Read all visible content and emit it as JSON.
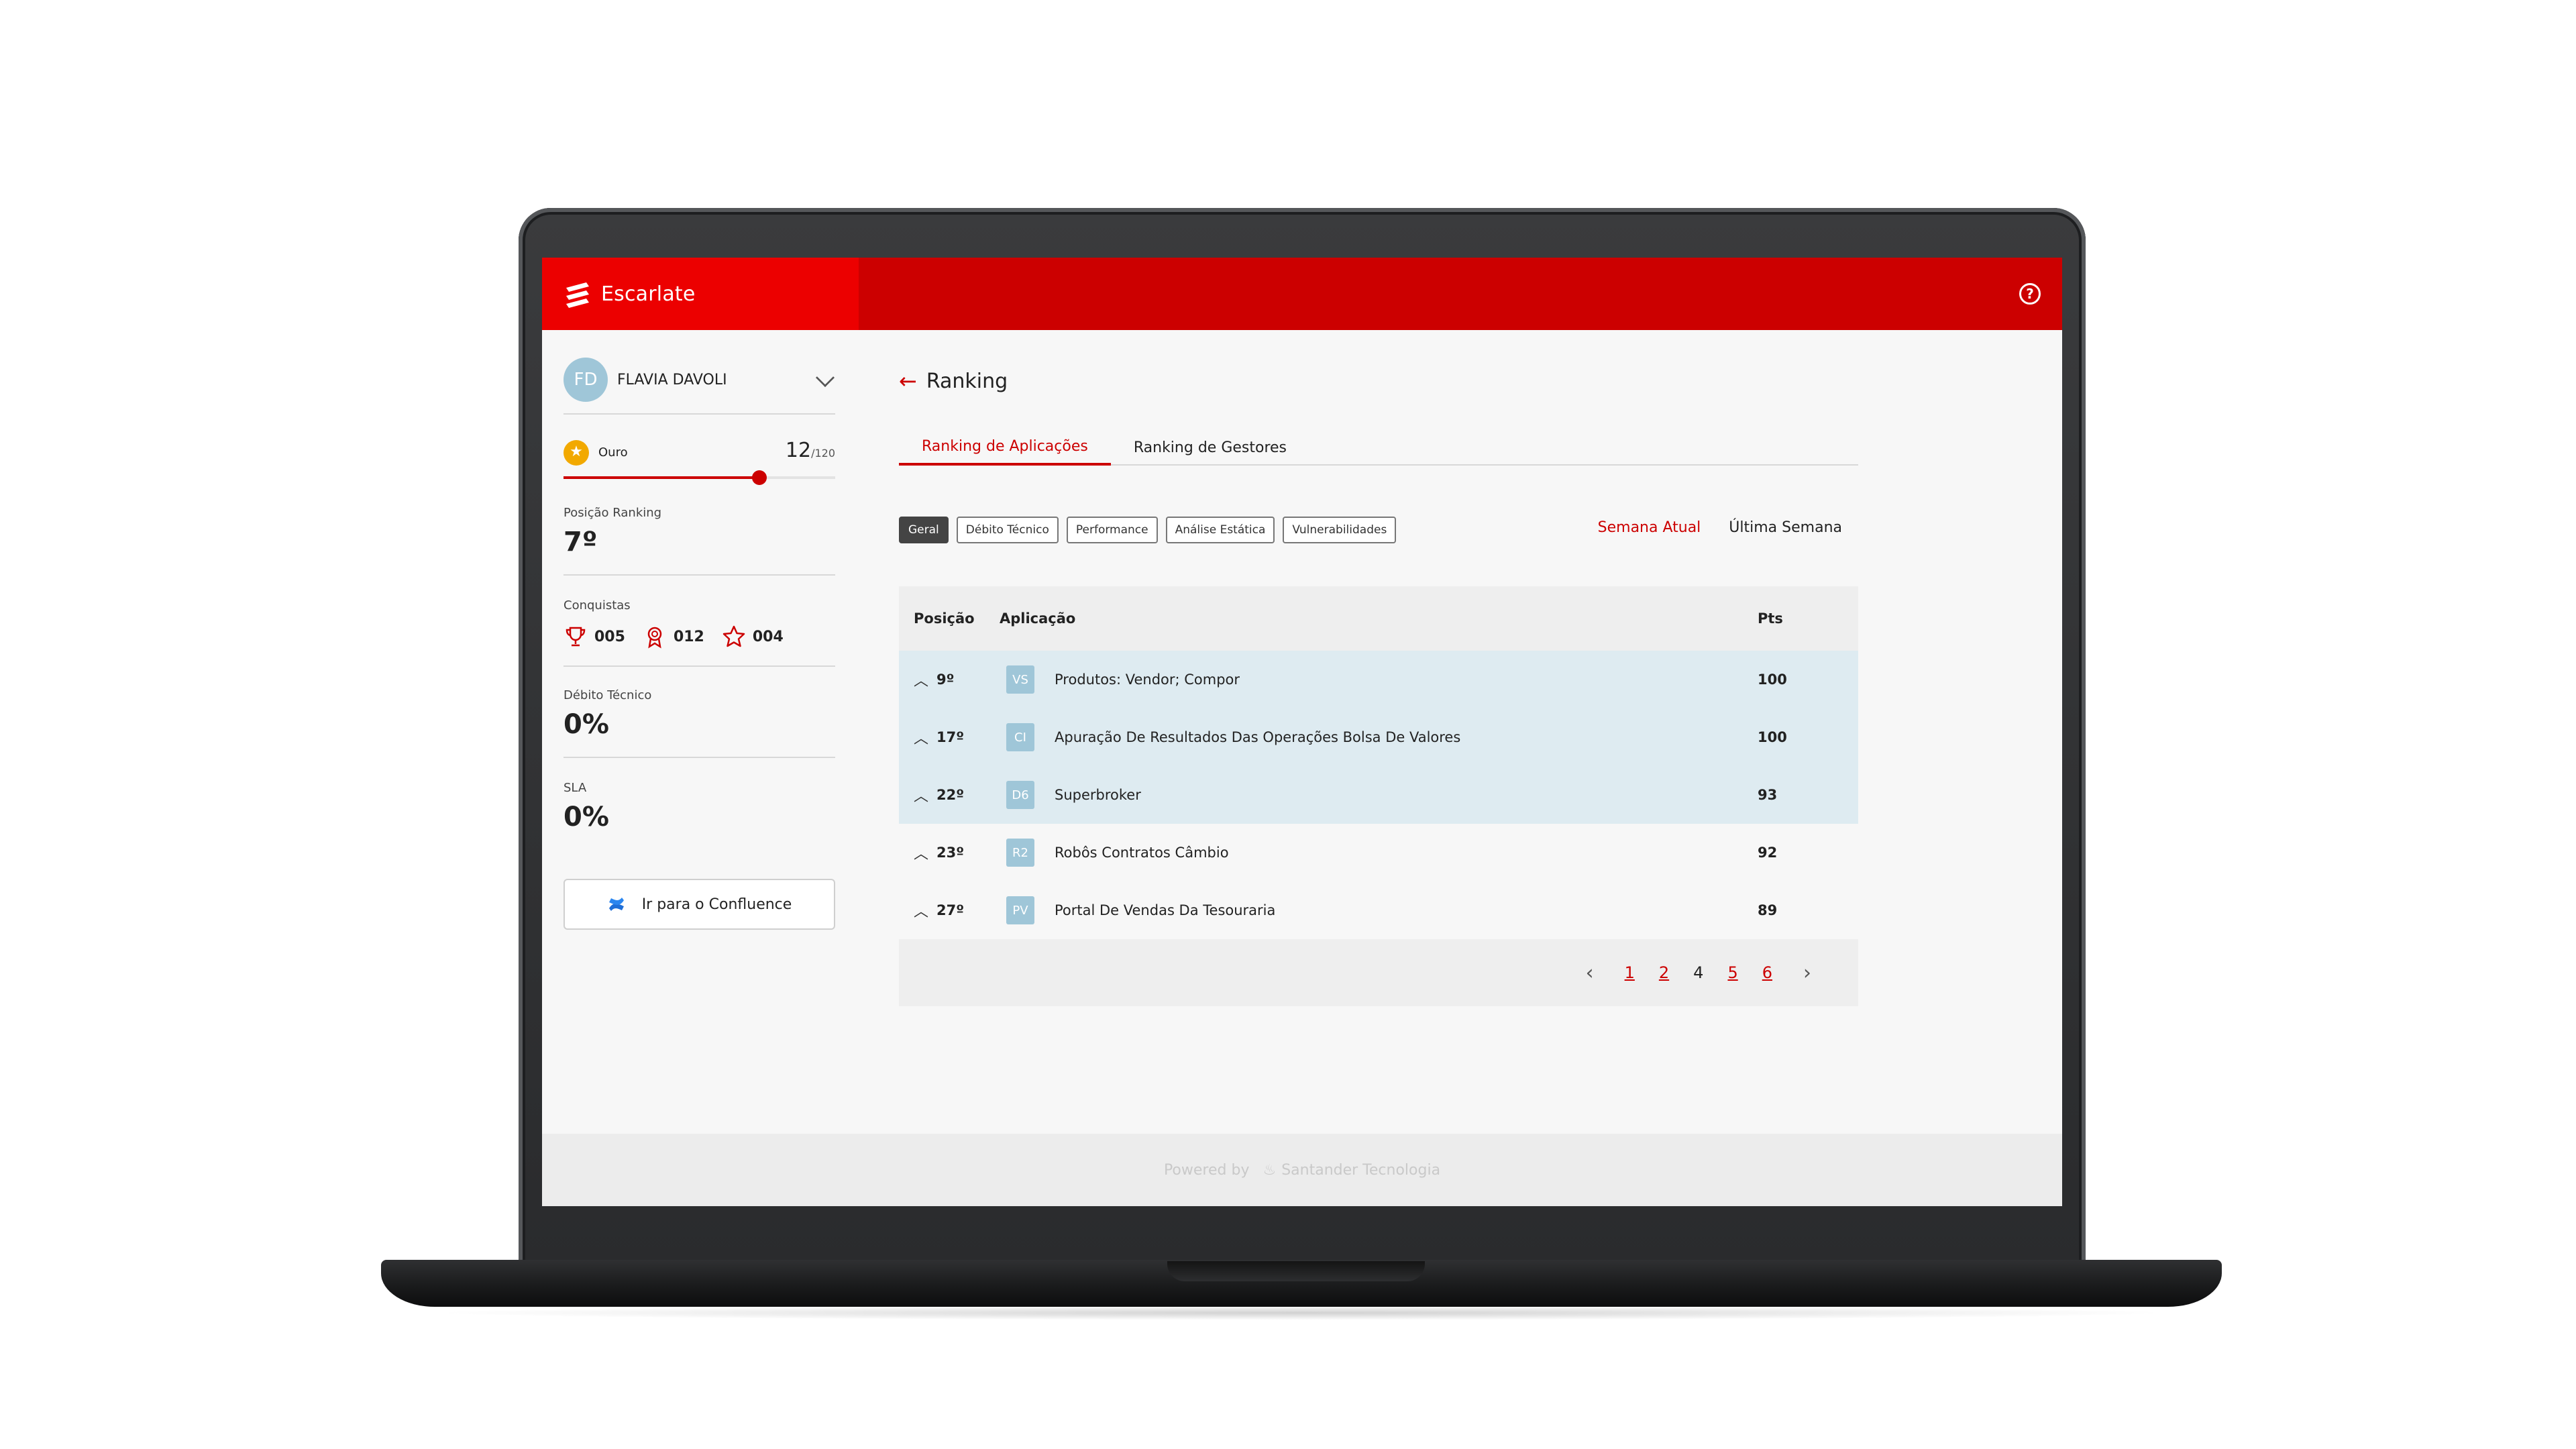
{
  "app": {
    "brand": "Escarlate",
    "accent": "#cc0000",
    "brand_red": "#ec0000"
  },
  "sidebar": {
    "user": {
      "initials": "FD",
      "name": "FLAVIA DAVOLI"
    },
    "level": {
      "name": "Ouro",
      "current": "12",
      "total": "/120",
      "progress": 0.72
    },
    "ranking": {
      "label": "Posição Ranking",
      "value": "7º"
    },
    "achievements": {
      "label": "Conquistas",
      "items": [
        {
          "icon": "trophy-icon",
          "count": "005"
        },
        {
          "icon": "medal-icon",
          "count": "012"
        },
        {
          "icon": "star-icon",
          "count": "004"
        }
      ]
    },
    "tech_debt": {
      "label": "Débito Técnico",
      "value": "0%"
    },
    "sla": {
      "label": "SLA",
      "value": "0%"
    },
    "confluence_button": "Ir para o Confluence"
  },
  "main": {
    "title": "Ranking",
    "tabs": [
      {
        "label": "Ranking de Aplicações",
        "active": true
      },
      {
        "label": "Ranking de Gestores",
        "active": false
      }
    ],
    "filters": [
      {
        "label": "Geral",
        "active": true
      },
      {
        "label": "Débito Técnico",
        "active": false
      },
      {
        "label": "Performance",
        "active": false
      },
      {
        "label": "Análise Estática",
        "active": false
      },
      {
        "label": "Vulnerabilidades",
        "active": false
      }
    ],
    "week": {
      "current": "Semana Atual",
      "last": "Última Semana"
    },
    "table": {
      "headers": {
        "position": "Posição",
        "app": "Aplicação",
        "points": "Pts"
      },
      "rows": [
        {
          "rank": "9º",
          "code": "VS",
          "app": "Produtos: Vendor; Compor",
          "pts": "100",
          "highlight": true
        },
        {
          "rank": "17º",
          "code": "CI",
          "app": "Apuração De Resultados Das Operações Bolsa De Valores",
          "pts": "100",
          "highlight": true
        },
        {
          "rank": "22º",
          "code": "D6",
          "app": "Superbroker",
          "pts": "93",
          "highlight": true
        },
        {
          "rank": "23º",
          "code": "R2",
          "app": "Robôs Contratos Câmbio",
          "pts": "92",
          "highlight": false
        },
        {
          "rank": "27º",
          "code": "PV",
          "app": "Portal De Vendas Da Tesouraria",
          "pts": "89",
          "highlight": false
        }
      ]
    },
    "pagination": {
      "pages": [
        "1",
        "2",
        "4",
        "5",
        "6"
      ],
      "current": "4"
    }
  },
  "footer": {
    "powered_by": "Powered by",
    "company": "Santander Tecnologia"
  }
}
